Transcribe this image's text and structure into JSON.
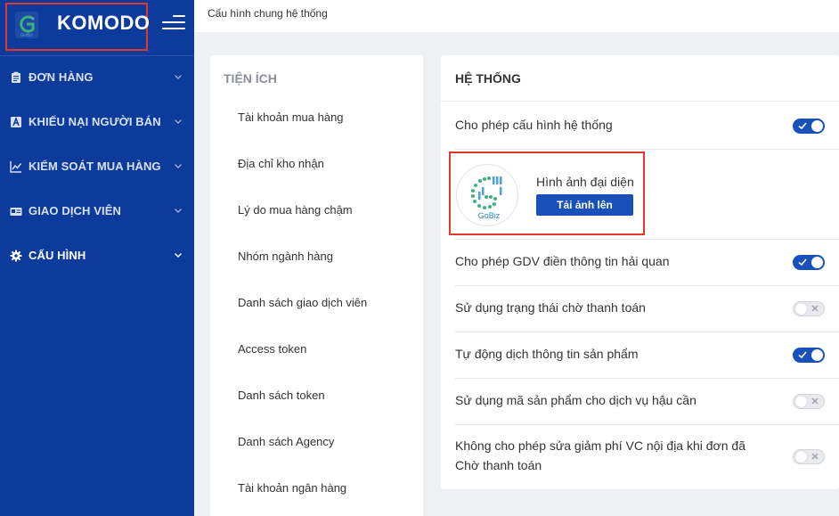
{
  "brand": {
    "name": "KOMODO",
    "logo_icon": "gobiz-g-logo",
    "logo_text": "GoBiz"
  },
  "sidebar": {
    "items": [
      {
        "label": "ĐƠN HÀNG",
        "icon": "clipboard-icon"
      },
      {
        "label": "KHIẾU NẠI NGƯỜI BÁN",
        "icon": "letter-a-box-icon"
      },
      {
        "label": "KIỂM SOÁT MUA HÀNG",
        "icon": "line-chart-icon"
      },
      {
        "label": "GIAO DỊCH VIÊN",
        "icon": "id-card-icon"
      },
      {
        "label": "CẤU HÌNH",
        "icon": "gear-icon"
      }
    ]
  },
  "header": {
    "breadcrumb": "Cấu hình chung hệ thống"
  },
  "utilities": {
    "title": "TIỆN ÍCH",
    "links": [
      "Tài khoản mua hàng",
      "Địa chỉ kho nhận",
      "Lý do mua hàng chậm",
      "Nhóm ngành hàng",
      "Danh sách giao dịch viên",
      "Access token",
      "Danh sách token",
      "Danh sách Agency",
      "Tài khoản ngân hàng"
    ]
  },
  "system": {
    "title": "HỆ THỐNG",
    "allow_config": {
      "label": "Cho phép cấu hình hệ thống",
      "enabled": true
    },
    "avatar": {
      "label": "Hình ảnh đại diện",
      "upload_label": "Tải ảnh lên",
      "image_text": "GoBiz"
    },
    "settings": [
      {
        "label": "Cho phép GDV điền thông tin hải quan",
        "enabled": true
      },
      {
        "label": "Sử dụng trạng thái chờ thanh toán",
        "enabled": false
      },
      {
        "label": "Tự động dịch thông tin sản phẩm",
        "enabled": true
      },
      {
        "label": "Sử dụng mã sản phẩm cho dịch vụ hậu cần",
        "enabled": false
      },
      {
        "label_line1": "Không cho phép sửa giảm phí VC nội địa khi đơn đã",
        "label_line2": "Chờ thanh toán",
        "enabled": false
      }
    ]
  },
  "colors": {
    "sidebar_bg": "#0c3b9c",
    "accent": "#1751b9",
    "highlight_border": "#e0392b",
    "page_bg": "#eef0f4"
  }
}
